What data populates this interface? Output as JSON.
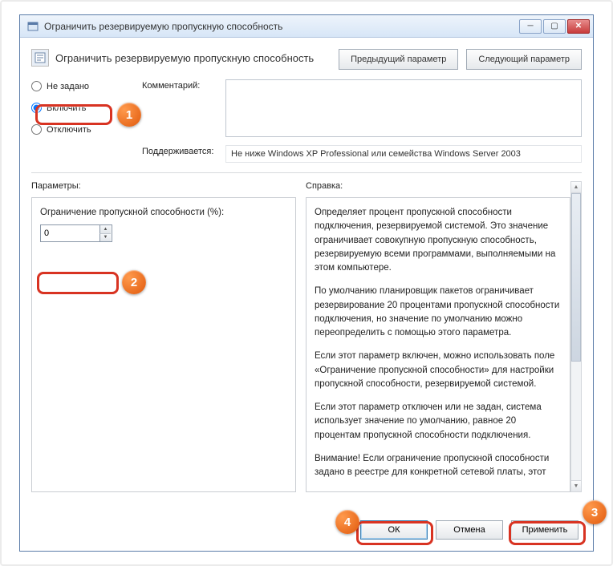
{
  "titlebar": {
    "title": "Ограничить резервируемую пропускную способность"
  },
  "header": {
    "title": "Ограничить резервируемую пропускную способность",
    "prev": "Предыдущий параметр",
    "next": "Следующий параметр"
  },
  "radios": {
    "not_configured": "Не задано",
    "enabled": "Включить",
    "disabled": "Отключить"
  },
  "labels": {
    "comment": "Комментарий:",
    "supported": "Поддерживается:",
    "params": "Параметры:",
    "help": "Справка:",
    "param_field": "Ограничение пропускной способности (%):"
  },
  "supported_text": "Не ниже Windows XP Professional или семейства Windows Server 2003",
  "param_value": "0",
  "help": {
    "p1": "Определяет процент пропускной способности подключения, резервируемой системой. Это значение ограничивает совокупную пропускную способность, резервируемую всеми программами, выполняемыми на этом компьютере.",
    "p2": "По умолчанию планировщик пакетов ограничивает резервирование 20 процентами пропускной способности подключения, но значение по умолчанию можно переопределить с помощью этого параметра.",
    "p3": "Если этот параметр включен, можно использовать поле «Ограничение пропускной способности» для настройки пропускной способности, резервируемой системой.",
    "p4": "Если этот параметр отключен или не задан, система использует значение по умолчанию, равное 20 процентам пропускной способности подключения.",
    "p5": "Внимание! Если ограничение пропускной способности задано в реестре для конкретной сетевой платы, этот"
  },
  "buttons": {
    "ok": "ОК",
    "cancel": "Отмена",
    "apply": "Применить"
  },
  "callouts": {
    "c1": "1",
    "c2": "2",
    "c3": "3",
    "c4": "4"
  }
}
